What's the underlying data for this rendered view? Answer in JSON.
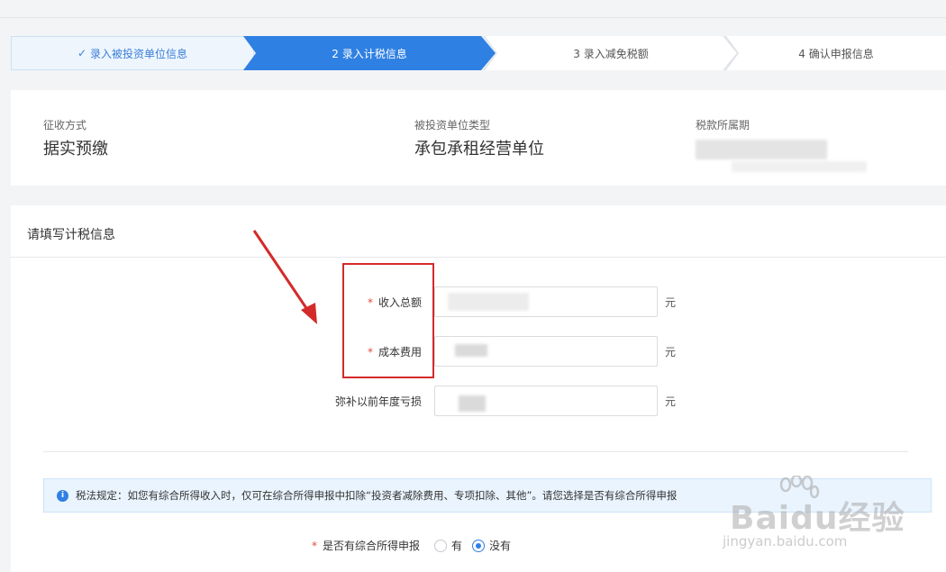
{
  "stepper": {
    "steps": [
      {
        "label": "录入被投资单位信息",
        "state": "done"
      },
      {
        "label": "2 录入计税信息",
        "state": "active"
      },
      {
        "label": "3 录入减免税额",
        "state": "pending"
      },
      {
        "label": "4 确认申报信息",
        "state": "pending"
      }
    ]
  },
  "info": {
    "collection_method_label": "征收方式",
    "collection_method_value": "据实预缴",
    "entity_type_label": "被投资单位类型",
    "entity_type_value": "承包承租经营单位",
    "tax_period_label": "税款所属期"
  },
  "form": {
    "title": "请填写计税信息",
    "fields": [
      {
        "label": "收入总额",
        "required": true,
        "unit": "元"
      },
      {
        "label": "成本费用",
        "required": true,
        "unit": "元"
      },
      {
        "label": "弥补以前年度亏损",
        "required": false,
        "unit": "元"
      }
    ],
    "required_mark": "*"
  },
  "notice": {
    "icon": "info-icon",
    "text": "税法规定：如您有综合所得收入时，仅可在综合所得申报中扣除“投资者减除费用、专项扣除、其他”。请您选择是否有综合所得申报"
  },
  "radio_group": {
    "label": "是否有综合所得申报",
    "options": [
      {
        "label": "有",
        "checked": false
      },
      {
        "label": "没有",
        "checked": true
      }
    ]
  },
  "watermark": {
    "text": "Baidu经验",
    "sub": "jingyan.baidu.com"
  },
  "colors": {
    "primary": "#2f80e3",
    "required": "#e64b3b",
    "annotation_red": "#d42a2a"
  }
}
